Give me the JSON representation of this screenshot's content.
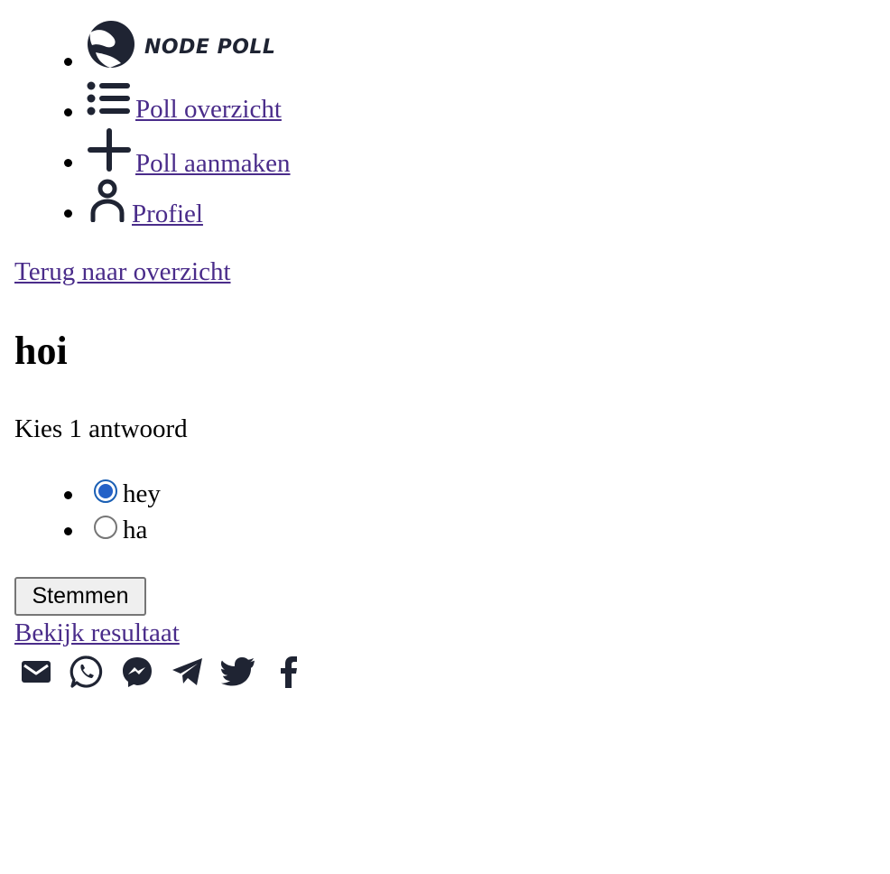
{
  "nav": {
    "logo_text": "NODE POLL",
    "items": [
      {
        "label": "Poll overzicht",
        "icon": "list-icon"
      },
      {
        "label": "Poll aanmaken",
        "icon": "plus-icon"
      },
      {
        "label": "Profiel",
        "icon": "user-icon"
      }
    ]
  },
  "back_link": "Terug naar overzicht",
  "poll": {
    "title": "hoi",
    "instruction": "Kies 1 antwoord",
    "options": [
      {
        "label": "hey",
        "selected": true
      },
      {
        "label": "ha",
        "selected": false
      }
    ]
  },
  "vote_button": "Stemmen",
  "results_link": "Bekijk resultaat",
  "share_icons": [
    "email-icon",
    "whatsapp-icon",
    "messenger-icon",
    "telegram-icon",
    "twitter-icon",
    "facebook-icon"
  ],
  "colors": {
    "link": "#4a2c8a",
    "icon": "#1f2433",
    "radio_checked": "#2461c7"
  }
}
